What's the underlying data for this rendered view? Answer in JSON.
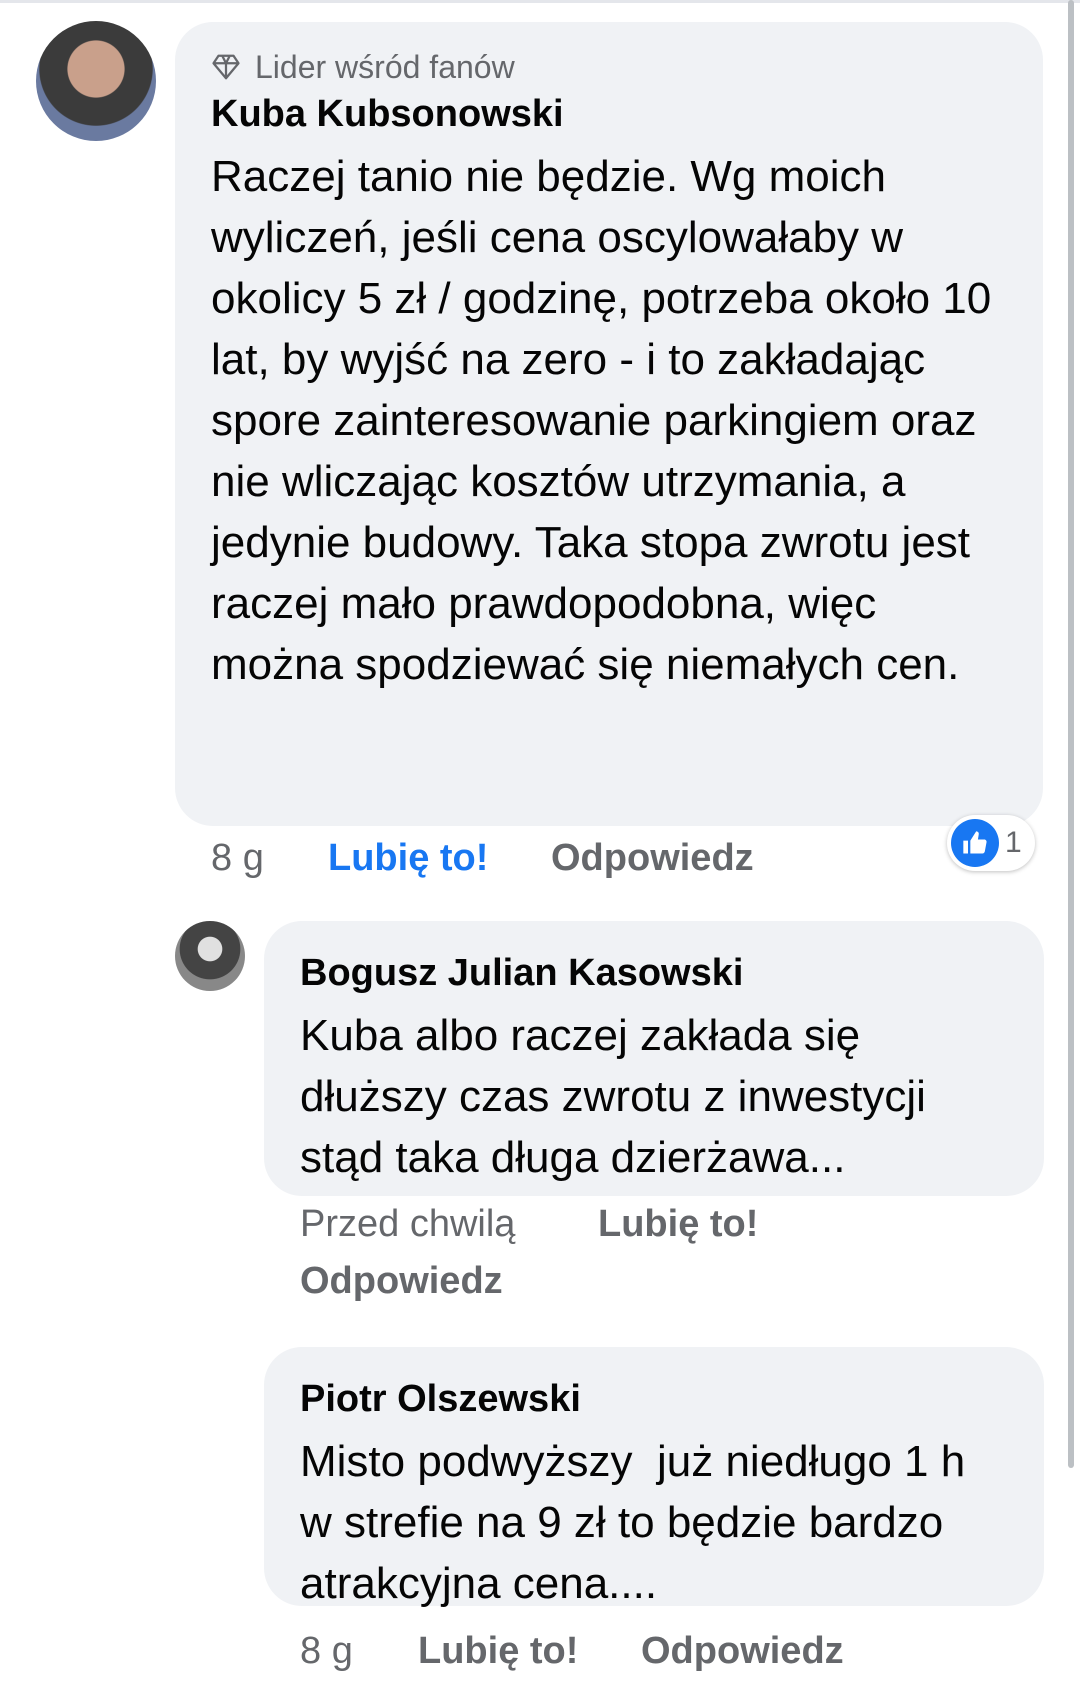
{
  "comments": [
    {
      "badge": "Lider wśród fanów",
      "author": "Kuba Kubsonowski",
      "text": "Raczej tanio nie będzie. Wg moich wyliczeń, jeśli cena oscylowałaby w okolicy 5 zł / godzinę, potrzeba około 10 lat, by wyjść na zero - i to zakładając spore zainteresowanie parkingiem oraz nie wliczając kosztów utrzymania, a jedynie budowy. Taka stopa zwrotu jest raczej mało prawdopodobna, więc można spodziewać się niemałych cen.",
      "time": "8 g",
      "like_label": "Lubię to!",
      "reply_label": "Odpowiedz",
      "reaction_count": "1"
    },
    {
      "author": "Bogusz Julian Kasowski",
      "text": "Kuba albo raczej zakłada się dłuższy czas zwrotu z inwestycji stąd taka długa dzierżawa...",
      "time": "Przed chwilą",
      "like_label": "Lubię to!",
      "reply_label": "Odpowiedz"
    },
    {
      "author": "Piotr Olszewski",
      "text": "Misto podwyższy  już niedługo 1 h  w strefie na 9 zł to będzie bardzo atrakcyjna cena....",
      "time": "8 g",
      "like_label": "Lubię to!",
      "reply_label": "Odpowiedz"
    }
  ],
  "colors": {
    "bubble": "#f0f2f5",
    "like_blue": "#1877f2",
    "meta_gray": "#65676b"
  },
  "icons": {
    "badge": "diamond-icon",
    "reaction": "thumbs-up-icon"
  }
}
